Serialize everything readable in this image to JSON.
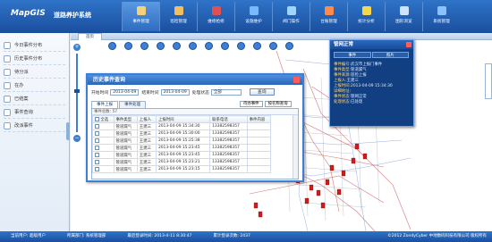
{
  "header": {
    "logo_text": "MapGIS",
    "app_title": "道路养护系统",
    "nav": [
      {
        "label": "事件管理",
        "active": true,
        "color": "#f5d17a"
      },
      {
        "label": "巡检管理",
        "active": false,
        "color": "#f0c060"
      },
      {
        "label": "维修抢修",
        "active": false,
        "color": "#e05050"
      },
      {
        "label": "设施维护",
        "active": false,
        "color": "#7ab8ff"
      },
      {
        "label": "阀门操作",
        "active": false,
        "color": "#9fd6ff"
      },
      {
        "label": "台账管理",
        "active": false,
        "color": "#ff8a4a"
      },
      {
        "label": "统计分析",
        "active": false,
        "color": "#f6d64a"
      },
      {
        "label": "图形浏览",
        "active": false,
        "color": "#cfe3ff"
      },
      {
        "label": "系统管理",
        "active": false,
        "color": "#8cc1ff"
      }
    ]
  },
  "sidebar": {
    "items": [
      {
        "label": "今日事件分布",
        "icon": "calendar-icon"
      },
      {
        "label": "历史事件分布",
        "icon": "history-icon"
      },
      {
        "label": "待分派",
        "icon": "inbox-icon"
      },
      {
        "label": "在办",
        "icon": "clock-icon"
      },
      {
        "label": "已结案",
        "icon": "check-icon"
      },
      {
        "label": "事件查询",
        "icon": "search-icon"
      },
      {
        "label": "改派事件",
        "icon": "switch-icon"
      }
    ]
  },
  "map": {
    "tab_label": "首页"
  },
  "dialog": {
    "title": "历史事件查询",
    "start_label": "开始时间",
    "start_value": "2013-04-09",
    "end_label": "结束时间",
    "end_value": "2013-04-09",
    "status_label": "处理状态",
    "status_value": "全部",
    "query_button": "查询",
    "tabs": [
      "事件上报",
      "事件处理"
    ],
    "sub_filter": [
      "待办事件",
      "按名称查询"
    ],
    "info": "事件总数: 57",
    "columns": [
      "全选",
      "事件类型",
      "上报人",
      "上报时间",
      "联系电话",
      "事件内容"
    ],
    "rows": [
      {
        "type": "管道漏气",
        "reporter": "王建三",
        "time": "2013-04-09 15:34:30",
        "phone": "13382598357"
      },
      {
        "type": "管道漏气",
        "reporter": "王建三",
        "time": "2013-04-09 15:30:00",
        "phone": "13382598357"
      },
      {
        "type": "管道漏气",
        "reporter": "王建三",
        "time": "2013-04-09 15:25:38",
        "phone": "13382598357"
      },
      {
        "type": "管道漏气",
        "reporter": "王建三",
        "time": "2013-04-09 15:23:45",
        "phone": "13382598357"
      },
      {
        "type": "管道漏气",
        "reporter": "王建三",
        "time": "2013-04-09 15:23:45",
        "phone": "13382598357"
      },
      {
        "type": "管道漏气",
        "reporter": "王建三",
        "time": "2013-04-09 15:23:21",
        "phone": "13382598357"
      },
      {
        "type": "管道漏气",
        "reporter": "王建三",
        "time": "2013-04-09 15:23:15",
        "phone": "13382598357"
      }
    ]
  },
  "popup": {
    "title": "管网正常",
    "tabs": [
      "事件",
      "照片"
    ],
    "fields": [
      {
        "k": "事件编号:",
        "v": "武汉市上报门事件"
      },
      {
        "k": "事件类型:",
        "v": "管道漏气"
      },
      {
        "k": "事件来源:",
        "v": "巡检上报"
      },
      {
        "k": "上报人:",
        "v": "王建三"
      },
      {
        "k": "上报时间:",
        "v": "2013-04-09 15:34:30"
      },
      {
        "k": "详细地址:",
        "v": ""
      },
      {
        "k": "事件状态:",
        "v": "管网正常"
      },
      {
        "k": "处理状态:",
        "v": "已处理"
      }
    ]
  },
  "status": {
    "user": "当前用户: 超级用户",
    "dept": "所属部门: 系统管理部",
    "last_login": "最后登录时间: 2013-4-11 8:30:47",
    "count": "累计登录次数: 2437",
    "copyright": "©2012 ZondyCyber 中地数码科技有限公司 版权所有"
  }
}
